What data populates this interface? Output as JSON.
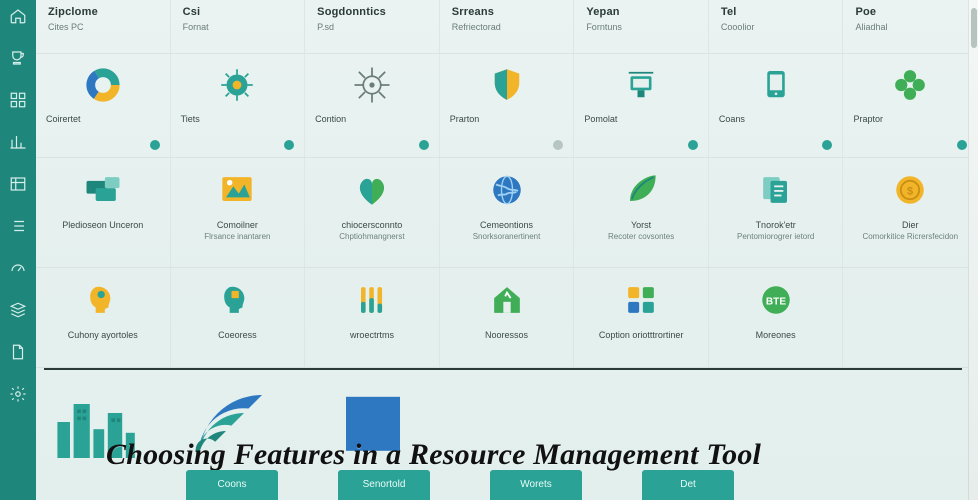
{
  "overlay_title": "Choosing Features in a Resource Management Tool",
  "rail": [
    {
      "name": "home-icon"
    },
    {
      "name": "cup-icon"
    },
    {
      "name": "grid-icon"
    },
    {
      "name": "chart-icon"
    },
    {
      "name": "table-icon"
    },
    {
      "name": "list-icon"
    },
    {
      "name": "gauge-icon"
    },
    {
      "name": "stack-icon"
    },
    {
      "name": "document-icon"
    },
    {
      "name": "gear-icon"
    }
  ],
  "headers": [
    {
      "title": "Zipclome",
      "sub": "Cites PC"
    },
    {
      "title": "Csi",
      "sub": "Fornat"
    },
    {
      "title": "Sogdonntics",
      "sub": "P.sd"
    },
    {
      "title": "Srreans",
      "sub": "Refriectorad"
    },
    {
      "title": "Yepan",
      "sub": "Forntuns"
    },
    {
      "title": "Tel",
      "sub": "Cooolior"
    },
    {
      "title": "Poe",
      "sub": "Aliadhal"
    }
  ],
  "rows": [
    {
      "cells": [
        {
          "icon": "donut-tricolor",
          "label": "Coirertet"
        },
        {
          "icon": "germ-green",
          "label": "Tiets"
        },
        {
          "icon": "virus-outline",
          "label": "Contion"
        },
        {
          "icon": "shield-split",
          "label": "Prarton"
        },
        {
          "icon": "cart-teal",
          "label": "Pomolat"
        },
        {
          "icon": "tablet-teal",
          "label": "Coans"
        },
        {
          "icon": "clover-green",
          "label": "Praptor"
        }
      ]
    },
    {
      "cells": [
        {
          "icon": "cards-teal",
          "label": "Pledioseon Unceron",
          "sub": ""
        },
        {
          "icon": "photo-yellow",
          "label": "Comoilner",
          "sub": "Flrsance inantaren"
        },
        {
          "icon": "heart-green",
          "label": "chiocersconnto",
          "sub": "Chptiohmangnerst"
        },
        {
          "icon": "globe-blue",
          "label": "Cemeontions",
          "sub": "Snorksoranertinent"
        },
        {
          "icon": "leaf-green",
          "label": "Yorst",
          "sub": "Recoter covsontes"
        },
        {
          "icon": "docs-teal",
          "label": "Tnorok'etr",
          "sub": "Pentomiorogrer ietord"
        },
        {
          "icon": "coin-yellow",
          "label": "Dier",
          "sub": "Comorkitice Ricrersfecidon"
        }
      ]
    },
    {
      "cells": [
        {
          "icon": "head-yellow",
          "label": "Cuhony ayortoles"
        },
        {
          "icon": "head-teal",
          "label": "Coeoress"
        },
        {
          "icon": "tubes-yellow",
          "label": "wroectrtms"
        },
        {
          "icon": "house-green",
          "label": "Nooressos"
        },
        {
          "icon": "apps-multi",
          "label": "Coption oriotttrortiner"
        },
        {
          "icon": "badge-green",
          "label": "Moreones"
        },
        {
          "icon": "",
          "label": ""
        }
      ]
    }
  ],
  "pills": [
    "Coons",
    "Senortold",
    "Worets",
    "Det"
  ],
  "colors": {
    "teal": "#1f867b",
    "accent": "#2aa396",
    "yellow": "#f2b52a",
    "blue": "#2e78c2",
    "green": "#3fae57"
  }
}
